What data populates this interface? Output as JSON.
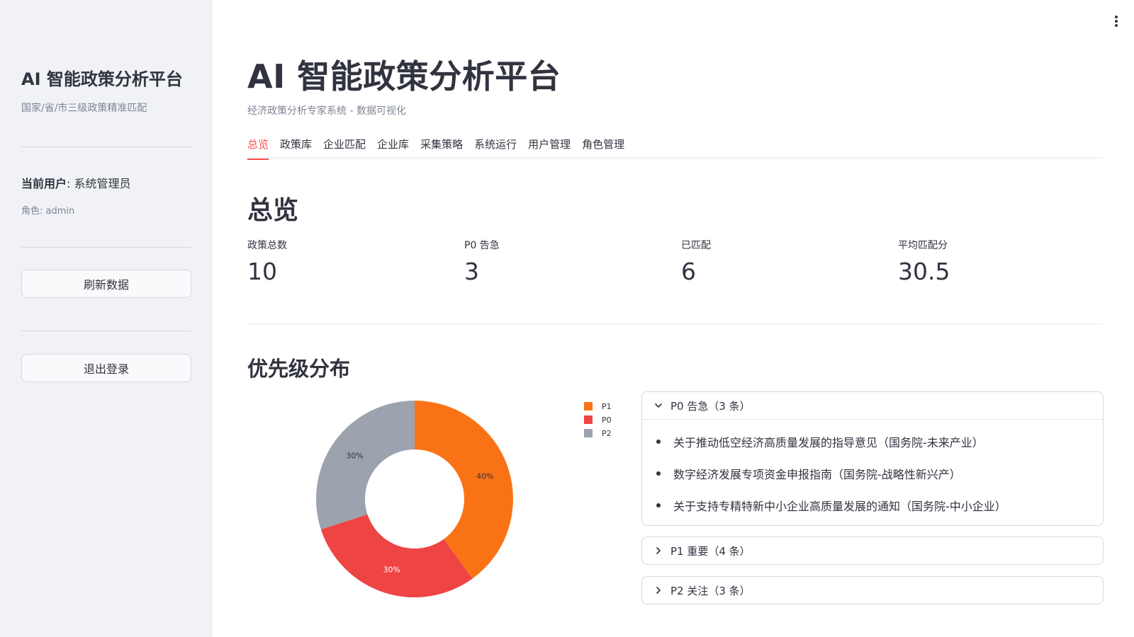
{
  "sidebar": {
    "title": "AI 智能政策分析平台",
    "subtitle": "国家/省/市三级政策精准匹配",
    "user_label": "当前用户",
    "user_name": ": 系统管理员",
    "role": "角色: admin",
    "refresh_button": "刷新数据",
    "logout_button": "退出登录"
  },
  "header": {
    "menu_icon": "kebab-menu-icon",
    "title": "AI 智能政策分析平台",
    "caption": "经济政策分析专家系统 - 数据可视化"
  },
  "tabs": [
    {
      "label": "总览",
      "active": true
    },
    {
      "label": "政策库",
      "active": false
    },
    {
      "label": "企业匹配",
      "active": false
    },
    {
      "label": "企业库",
      "active": false
    },
    {
      "label": "采集策略",
      "active": false
    },
    {
      "label": "系统运行",
      "active": false
    },
    {
      "label": "用户管理",
      "active": false
    },
    {
      "label": "角色管理",
      "active": false
    }
  ],
  "overview": {
    "title": "总览",
    "metrics": [
      {
        "label": "政策总数",
        "value": "10"
      },
      {
        "label": "P0 告急",
        "value": "3"
      },
      {
        "label": "已匹配",
        "value": "6"
      },
      {
        "label": "平均匹配分",
        "value": "30.5"
      }
    ]
  },
  "priority": {
    "title": "优先级分布",
    "expanders": [
      {
        "title": "P0 告急（3 条）",
        "expanded": true,
        "items": [
          "关于推动低空经济高质量发展的指导意见（国务院-未来产业）",
          "数字经济发展专项资金申报指南（国务院-战略性新兴产）",
          "关于支持专精特新中小企业高质量发展的通知（国务院-中小企业）"
        ]
      },
      {
        "title": "P1 重要（4 条）",
        "expanded": false,
        "items": []
      },
      {
        "title": "P2 关注（3 条）",
        "expanded": false,
        "items": []
      }
    ]
  },
  "colors": {
    "accent": "#ff4b4b",
    "P1": "#f97316",
    "P0": "#ef4444",
    "P2": "#9ca3af"
  },
  "chart_data": {
    "type": "pie",
    "donut": true,
    "categories": [
      "P1",
      "P0",
      "P2"
    ],
    "values": [
      40,
      30,
      30
    ],
    "labels": [
      "40%",
      "30%",
      "30%"
    ],
    "colors": [
      "#f97316",
      "#ef4444",
      "#9ca3af"
    ],
    "legend": "right"
  }
}
